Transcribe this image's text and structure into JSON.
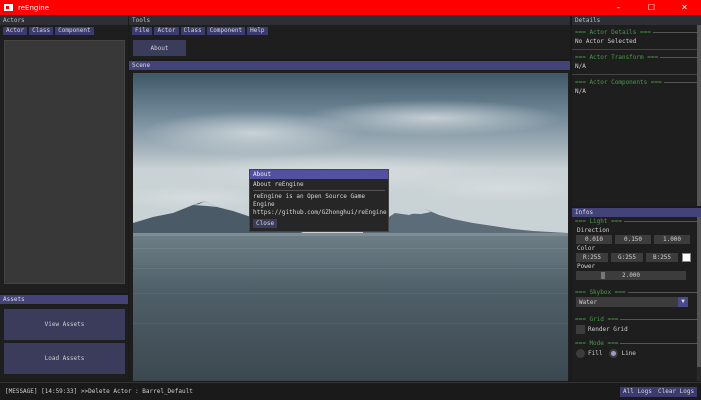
{
  "window": {
    "title": "reEngine",
    "minimize": "–",
    "maximize": "☐",
    "close": "✕"
  },
  "actors_panel": {
    "title": "Actors",
    "tabs": [
      "Actor",
      "Class",
      "Component"
    ]
  },
  "assets_panel": {
    "title": "Assets",
    "view_button": "View Assets",
    "load_button": "Load Assets"
  },
  "tools_panel": {
    "title": "Tools",
    "tabs": [
      "File",
      "Actor",
      "Class",
      "Component",
      "Help"
    ],
    "about_button": "About"
  },
  "scene_panel": {
    "title": "Scene"
  },
  "about_modal": {
    "title": "About",
    "heading": "About reEngine",
    "line1": "reEngine is an Open Source Game Engine",
    "line2": "https://github.com/GZhonghui/reEngine",
    "close_button": "Close"
  },
  "details_panel": {
    "title": "Details",
    "actor_details_header": "=== Actor Details ===",
    "actor_details_value": "No Actor Selected",
    "actor_transform_header": "=== Actor Transform ===",
    "actor_transform_value": "N/A",
    "actor_components_header": "=== Actor Components ===",
    "actor_components_value": "N/A"
  },
  "infos_panel": {
    "title": "Infos",
    "light_header": "=== Light ===",
    "direction_label": "Direction",
    "direction": [
      "0.010",
      "0.150",
      "1.000"
    ],
    "color_label": "Color",
    "color": [
      "R:255",
      "G:255",
      "B:255"
    ],
    "power_label": "Power",
    "power_value": "2.000",
    "skybox_header": "=== Skybox ===",
    "skybox_value": "Water",
    "grid_header": "=== Grid ===",
    "render_grid_label": "Render Grid",
    "mode_header": "=== Mode ===",
    "mode_fill": "Fill",
    "mode_line": "Line"
  },
  "log_bar": {
    "message": "[MESSAGE] [14:59:33] >>Delete Actor : Barrel_Default",
    "all_logs": "All Logs",
    "clear_logs": "Clear Logs"
  }
}
